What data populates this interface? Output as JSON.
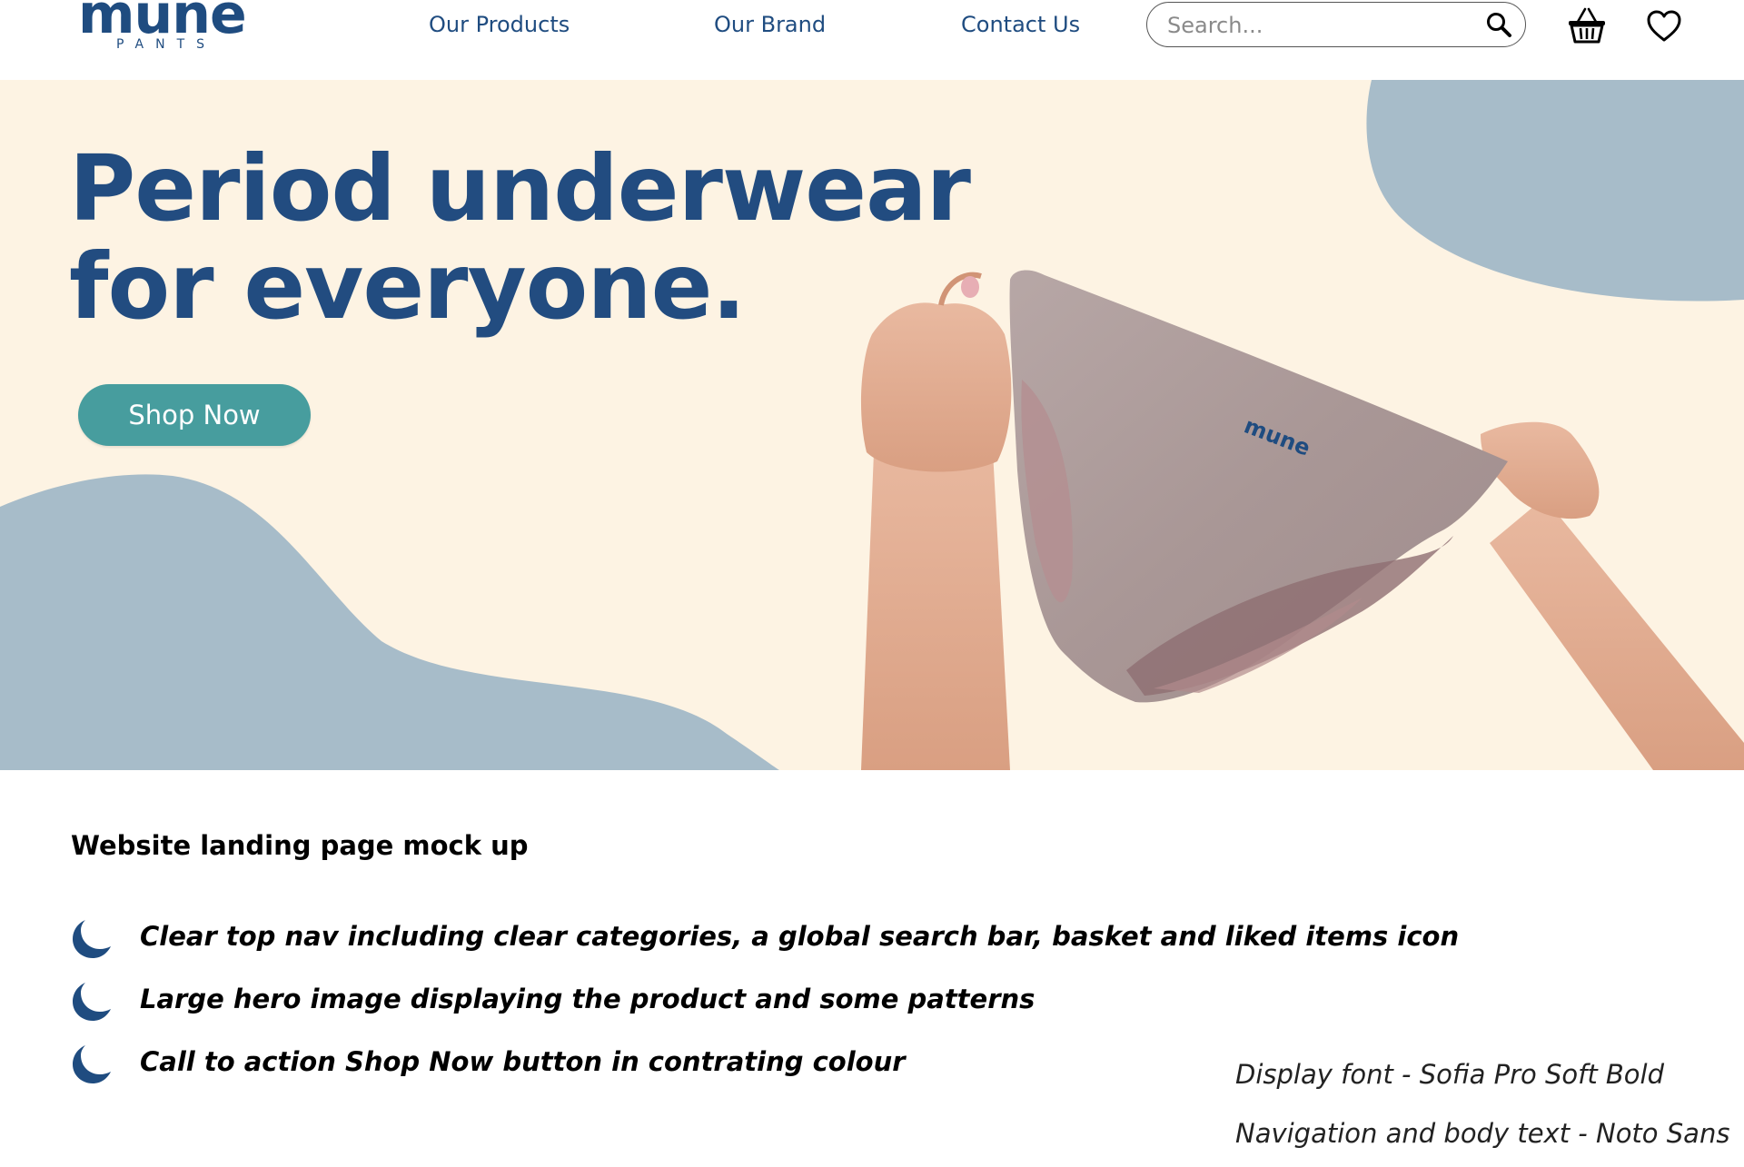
{
  "brand": {
    "wordmark": "mune",
    "subline": "PANTS",
    "product_wordmark": "mune",
    "primary_color": "#1f4c80",
    "accent_color": "#479d9e",
    "cream_color": "#fdf3e3",
    "blob_color": "#a7bcc9"
  },
  "nav": {
    "links": [
      "Our Products",
      "Our Brand",
      "Contact Us"
    ],
    "search_placeholder": "Search...",
    "icons": [
      "search-icon",
      "basket-icon",
      "heart-icon"
    ]
  },
  "hero": {
    "title_line1": "Period underwear",
    "title_line2": "for everyone.",
    "cta_label": "Shop Now"
  },
  "notes": {
    "heading": "Website landing page mock up",
    "bullet_icon": "moon-icon",
    "bullets": [
      "Clear top nav including clear categories, a global search bar, basket and liked items icon",
      "Large hero image displaying the product and some patterns",
      "Call to action Shop Now button in contrating colour"
    ],
    "display_font_note": "Display font - Sofia Pro Soft Bold",
    "body_font_note": "Navigation and body text - Noto Sans"
  }
}
